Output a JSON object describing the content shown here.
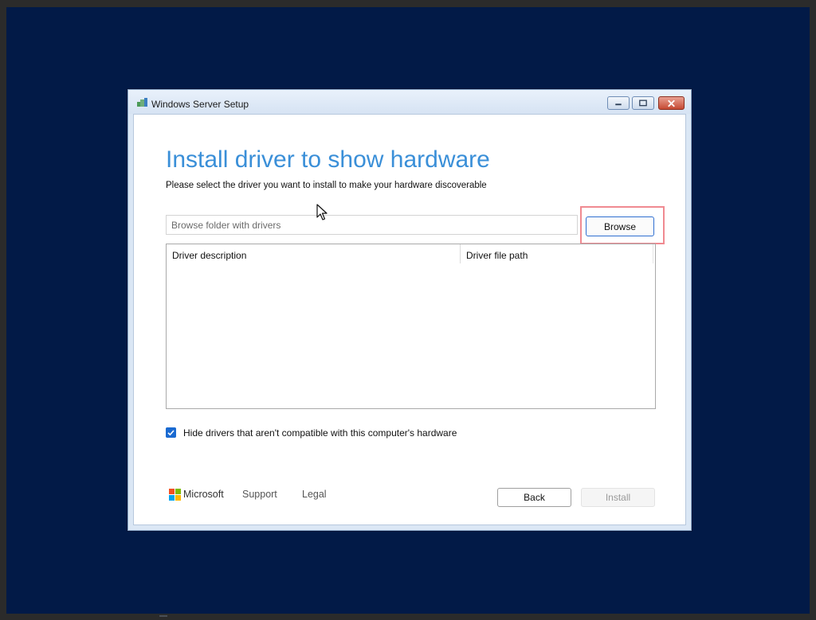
{
  "window": {
    "title": "Windows Server Setup",
    "icon": "setup-icon",
    "controls": [
      "minimize-icon",
      "maximize-icon",
      "close-icon"
    ]
  },
  "page": {
    "title": "Install driver to show hardware",
    "subtitle": "Please select the driver you want to install to make your hardware discoverable"
  },
  "folder_input": {
    "placeholder": "Browse folder with drivers",
    "value": ""
  },
  "browse_button": {
    "label": "Browse"
  },
  "table": {
    "columns": [
      "Driver description",
      "Driver file path"
    ],
    "rows": []
  },
  "hide_incompatible": {
    "label": "Hide drivers that aren't compatible with this computer's hardware",
    "checked": true
  },
  "footer": {
    "brand": "Microsoft",
    "support_label": "Support",
    "legal_label": "Legal",
    "back_label": "Back",
    "install_label": "Install",
    "install_enabled": false
  },
  "colors": {
    "desktop": "#021a47",
    "title_accent": "#3a8fd8",
    "checkbox": "#1a6ad1",
    "highlight": "#f08a91"
  }
}
